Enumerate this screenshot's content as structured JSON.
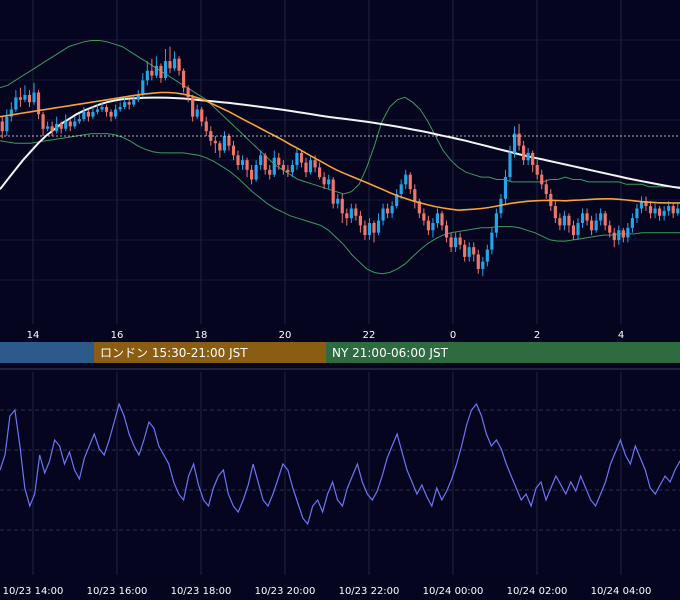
{
  "chart_data": [
    {
      "type": "candlestick",
      "x_tick_labels": [
        "14",
        "16",
        "18",
        "20",
        "22",
        "0",
        "2",
        "4"
      ],
      "candles_ohlc": [
        [
          108,
          104,
          110,
          101
        ],
        [
          104,
          110,
          113,
          102
        ],
        [
          110,
          113,
          116,
          108
        ],
        [
          113,
          118,
          121,
          112
        ],
        [
          118,
          117,
          122,
          114
        ],
        [
          117,
          119,
          123,
          116
        ],
        [
          119,
          116,
          121,
          114
        ],
        [
          116,
          120,
          124,
          115
        ],
        [
          120,
          111,
          121,
          109
        ],
        [
          111,
          105,
          112,
          102
        ],
        [
          105,
          106,
          108,
          104
        ],
        [
          106,
          104,
          108,
          102
        ],
        [
          104,
          107,
          110,
          103
        ],
        [
          107,
          105,
          108,
          103
        ],
        [
          105,
          108,
          111,
          104
        ],
        [
          108,
          106,
          109,
          104
        ],
        [
          106,
          108,
          110,
          105
        ],
        [
          108,
          109,
          111,
          107
        ],
        [
          109,
          112,
          114,
          108
        ],
        [
          112,
          110,
          113,
          108
        ],
        [
          110,
          112,
          114,
          109
        ],
        [
          112,
          113,
          115,
          111
        ],
        [
          113,
          114,
          116,
          112
        ],
        [
          114,
          112,
          115,
          110
        ],
        [
          112,
          110,
          113,
          108
        ],
        [
          110,
          113,
          115,
          109
        ],
        [
          113,
          114,
          116,
          112
        ],
        [
          114,
          116,
          118,
          113
        ],
        [
          116,
          115,
          117,
          113
        ],
        [
          115,
          117,
          119,
          114
        ],
        [
          117,
          119,
          121,
          116
        ],
        [
          119,
          125,
          128,
          118
        ],
        [
          125,
          129,
          133,
          123
        ],
        [
          129,
          127,
          134,
          125
        ],
        [
          127,
          131,
          135,
          126
        ],
        [
          131,
          126,
          132,
          124
        ],
        [
          126,
          133,
          138,
          125
        ],
        [
          133,
          130,
          139,
          128
        ],
        [
          130,
          134,
          137,
          129
        ],
        [
          134,
          129,
          135,
          127
        ],
        [
          129,
          122,
          130,
          120
        ],
        [
          122,
          118,
          123,
          116
        ],
        [
          118,
          110,
          119,
          108
        ],
        [
          110,
          113,
          115,
          109
        ],
        [
          113,
          108,
          114,
          106
        ],
        [
          108,
          104,
          110,
          102
        ],
        [
          104,
          100,
          106,
          98
        ],
        [
          100,
          99,
          102,
          95
        ],
        [
          99,
          96,
          100,
          93
        ],
        [
          96,
          102,
          104,
          95
        ],
        [
          102,
          98,
          103,
          96
        ],
        [
          98,
          94,
          100,
          92
        ],
        [
          94,
          90,
          96,
          88
        ],
        [
          90,
          92,
          94,
          88
        ],
        [
          92,
          88,
          93,
          85
        ],
        [
          88,
          84,
          90,
          82
        ],
        [
          84,
          90,
          92,
          83
        ],
        [
          90,
          94,
          96,
          88
        ],
        [
          94,
          88,
          95,
          86
        ],
        [
          88,
          86,
          90,
          84
        ],
        [
          86,
          93,
          96,
          85
        ],
        [
          93,
          90,
          95,
          88
        ],
        [
          90,
          88,
          92,
          86
        ],
        [
          88,
          87,
          90,
          85
        ],
        [
          87,
          90,
          92,
          85
        ],
        [
          90,
          95,
          97,
          88
        ],
        [
          95,
          91,
          96,
          89
        ],
        [
          91,
          87,
          93,
          85
        ],
        [
          87,
          92,
          94,
          86
        ],
        [
          92,
          89,
          94,
          87
        ],
        [
          89,
          85,
          91,
          84
        ],
        [
          85,
          82,
          87,
          80
        ],
        [
          82,
          84,
          86,
          80
        ],
        [
          84,
          74,
          85,
          72
        ],
        [
          74,
          76,
          78,
          72
        ],
        [
          76,
          70,
          78,
          66
        ],
        [
          70,
          68,
          72,
          65
        ],
        [
          68,
          72,
          74,
          66
        ],
        [
          72,
          69,
          74,
          67
        ],
        [
          69,
          65,
          71,
          62
        ],
        [
          65,
          61,
          67,
          59
        ],
        [
          61,
          66,
          68,
          59
        ],
        [
          66,
          62,
          67,
          58
        ],
        [
          62,
          67,
          70,
          61
        ],
        [
          67,
          72,
          74,
          65
        ],
        [
          72,
          70,
          74,
          68
        ],
        [
          70,
          73,
          75,
          68
        ],
        [
          73,
          78,
          80,
          72
        ],
        [
          78,
          82,
          84,
          76
        ],
        [
          82,
          86,
          88,
          80
        ],
        [
          86,
          80,
          87,
          78
        ],
        [
          80,
          75,
          82,
          72
        ],
        [
          75,
          70,
          76,
          68
        ],
        [
          70,
          67,
          72,
          65
        ],
        [
          67,
          63,
          69,
          61
        ],
        [
          63,
          66,
          68,
          60
        ],
        [
          66,
          70,
          72,
          64
        ],
        [
          70,
          65,
          71,
          63
        ],
        [
          65,
          60,
          67,
          58
        ],
        [
          60,
          56,
          62,
          54
        ],
        [
          56,
          60,
          62,
          54
        ],
        [
          60,
          57,
          62,
          55
        ],
        [
          57,
          52,
          59,
          50
        ],
        [
          52,
          56,
          58,
          50
        ],
        [
          56,
          53,
          58,
          50
        ],
        [
          53,
          47,
          55,
          45
        ],
        [
          47,
          50,
          52,
          44
        ],
        [
          50,
          55,
          57,
          48
        ],
        [
          55,
          62,
          64,
          53
        ],
        [
          62,
          70,
          72,
          60
        ],
        [
          70,
          76,
          78,
          68
        ],
        [
          76,
          85,
          88,
          74
        ],
        [
          85,
          95,
          98,
          83
        ],
        [
          95,
          103,
          106,
          93
        ],
        [
          103,
          98,
          107,
          96
        ],
        [
          98,
          92,
          100,
          90
        ],
        [
          92,
          95,
          97,
          90
        ],
        [
          95,
          90,
          96,
          87
        ],
        [
          90,
          86,
          92,
          84
        ],
        [
          86,
          82,
          88,
          80
        ],
        [
          82,
          78,
          84,
          76
        ],
        [
          78,
          73,
          80,
          71
        ],
        [
          73,
          68,
          75,
          66
        ],
        [
          68,
          65,
          70,
          63
        ],
        [
          65,
          69,
          71,
          63
        ],
        [
          69,
          65,
          70,
          62
        ],
        [
          65,
          61,
          67,
          59
        ],
        [
          61,
          66,
          68,
          59
        ],
        [
          66,
          70,
          72,
          64
        ],
        [
          70,
          67,
          72,
          65
        ],
        [
          67,
          63,
          69,
          61
        ],
        [
          63,
          67,
          70,
          62
        ],
        [
          67,
          70,
          72,
          65
        ],
        [
          70,
          65,
          71,
          63
        ],
        [
          65,
          62,
          67,
          60
        ],
        [
          62,
          59,
          64,
          56
        ],
        [
          59,
          63,
          65,
          57
        ],
        [
          63,
          60,
          64,
          58
        ],
        [
          60,
          64,
          66,
          58
        ],
        [
          64,
          68,
          70,
          62
        ],
        [
          68,
          72,
          74,
          66
        ],
        [
          72,
          75,
          77,
          70
        ],
        [
          75,
          73,
          77,
          71
        ],
        [
          73,
          70,
          75,
          68
        ],
        [
          70,
          72,
          74,
          68
        ],
        [
          72,
          69,
          73,
          67
        ],
        [
          69,
          71,
          73,
          67
        ],
        [
          71,
          73,
          75,
          69
        ],
        [
          73,
          70,
          74,
          68
        ],
        [
          70,
          72,
          74,
          69
        ]
      ],
      "sma_mid_values": [
        110,
        110.5,
        111,
        111.5,
        112,
        112.5,
        113,
        113.5,
        114,
        114.5,
        115,
        115.5,
        116,
        116.5,
        117,
        117.5,
        118,
        118.5,
        119,
        119.4,
        119.7,
        120,
        120,
        119.8,
        119.3,
        118.6,
        117.7,
        116.5,
        115,
        113.5,
        112,
        110.3,
        108.6,
        107,
        105.3,
        103.6,
        102,
        100.3,
        98.5,
        96.8,
        95,
        93.2,
        91.5,
        89.7,
        88,
        86.6,
        85.3,
        84,
        82.7,
        81.3,
        80,
        78.6,
        77.3,
        76.2,
        75.2,
        74.3,
        73.5,
        72.8,
        72.2,
        71.7,
        71.3,
        71.5,
        71.7,
        72,
        72.4,
        73,
        73.6,
        74.2,
        74.6,
        75,
        75.2,
        75.3,
        75.4,
        75.3,
        75.2,
        75.4,
        75.5,
        75.7,
        75.9,
        76,
        76,
        75.8,
        75.5,
        75.2,
        74.8,
        74.6,
        74.4,
        74.3,
        74.3,
        74.3
      ],
      "long_ma_values": [
        80,
        84,
        88,
        92,
        95.5,
        99,
        102,
        104.5,
        107,
        109,
        111,
        112.5,
        113.8,
        115,
        116,
        116.7,
        117.2,
        117.5,
        117.7,
        117.8,
        117.9,
        117.9,
        117.8,
        117.7,
        117.5,
        117.2,
        116.9,
        116.6,
        116.3,
        116,
        115.7,
        115.3,
        114.9,
        114.5,
        114.1,
        113.7,
        113.3,
        112.9,
        112.4,
        111.9,
        111.4,
        110.9,
        110.4,
        109.9,
        109.5,
        109.1,
        108.7,
        108.3,
        107.9,
        107.4,
        106.9,
        106.4,
        105.9,
        105.3,
        104.7,
        104.1,
        103.5,
        102.8,
        102.1,
        101.4,
        100.7,
        100,
        99.2,
        98.4,
        97.6,
        96.8,
        96,
        95.2,
        94.4,
        93.7,
        93,
        92.3,
        91.6,
        90.9,
        90.2,
        89.5,
        88.8,
        88.1,
        87.4,
        86.7,
        86,
        85.3,
        84.6,
        83.9,
        83.3,
        82.7,
        82.1,
        81.5,
        81,
        80.5
      ],
      "bollinger_upper_values": [
        122,
        123,
        125,
        127,
        129,
        131,
        133,
        135,
        137,
        139,
        140,
        141,
        141.5,
        141.5,
        141,
        140,
        139,
        137,
        135,
        133,
        131,
        129,
        127,
        125,
        123,
        121,
        119,
        117,
        114,
        111,
        108,
        105,
        102,
        99,
        96,
        93,
        90,
        88,
        86,
        84,
        83,
        82,
        81,
        80,
        79,
        78,
        79,
        82,
        89,
        98,
        108,
        114,
        117,
        118,
        116,
        113,
        108,
        102,
        96,
        92,
        89,
        87,
        86,
        85,
        85,
        84,
        84,
        83,
        83,
        83,
        83,
        83,
        84,
        84,
        85,
        84,
        84,
        83,
        83,
        83,
        83,
        83,
        82,
        82,
        82,
        81,
        81,
        81,
        81,
        81
      ],
      "bollinger_lower_values": [
        100,
        99.5,
        99,
        99,
        99,
        99.5,
        100,
        100.5,
        101,
        101.5,
        102,
        102.5,
        103,
        103,
        103,
        102.5,
        101.5,
        100,
        98,
        96.5,
        95.5,
        95,
        95,
        95,
        95,
        94.5,
        94,
        93,
        91.5,
        89.5,
        87.5,
        85,
        82,
        79,
        76.5,
        74,
        72,
        70.5,
        69,
        68,
        67,
        66,
        65,
        63,
        60,
        57,
        53,
        50,
        47,
        45.5,
        45,
        45.5,
        47,
        49,
        52,
        55,
        57.5,
        59.5,
        61,
        62,
        62.5,
        63,
        63.5,
        64,
        64,
        64.5,
        64.5,
        64.5,
        64,
        63,
        62,
        60.5,
        59,
        58.5,
        58.5,
        59,
        59.5,
        60,
        60.5,
        61,
        61,
        61.5,
        61.5,
        61.5,
        62,
        62,
        62,
        62,
        62,
        62
      ],
      "dashed_reference_level": 102
    },
    {
      "type": "line",
      "x_tick_labels": [
        "10/23 14:00",
        "10/23 16:00",
        "10/23 18:00",
        "10/23 20:00",
        "10/23 22:00",
        "10/24 00:00",
        "10/24 02:00",
        "10/24 04:00"
      ],
      "values": [
        50,
        55,
        68,
        70,
        58,
        44,
        38,
        42,
        55,
        49,
        53,
        60,
        58,
        52,
        56,
        50,
        47,
        54,
        58,
        62,
        57,
        55,
        60,
        66,
        72,
        68,
        62,
        58,
        55,
        60,
        66,
        64,
        58,
        55,
        52,
        46,
        42,
        40,
        48,
        52,
        45,
        40,
        38,
        44,
        48,
        50,
        42,
        38,
        36,
        40,
        45,
        52,
        46,
        40,
        38,
        42,
        47,
        52,
        50,
        44,
        39,
        34,
        32,
        38,
        40,
        36,
        42,
        46,
        40,
        38,
        44,
        48,
        52,
        46,
        42,
        40,
        43,
        48,
        54,
        58,
        62,
        56,
        50,
        46,
        42,
        45,
        41,
        38,
        44,
        40,
        43,
        47,
        52,
        58,
        65,
        70,
        72,
        68,
        62,
        58,
        60,
        57,
        52,
        48,
        44,
        40,
        42,
        38,
        44,
        46,
        40,
        44,
        48,
        45,
        42,
        46,
        43,
        48,
        44,
        40,
        38,
        42,
        46,
        52,
        56,
        60,
        55,
        52,
        58,
        54,
        50,
        44,
        42,
        45,
        48,
        46,
        50,
        53
      ],
      "ylim": [
        20,
        80
      ]
    }
  ],
  "session_bar": {
    "tokyo": {
      "label": "",
      "color": "#2c5a8a"
    },
    "london": {
      "label": "ロンドン 15:30-21:00 JST",
      "color": "#8a5d12"
    },
    "ny": {
      "label": "NY 21:00-06:00 JST",
      "color": "#2e6b40"
    }
  },
  "colors": {
    "background": "#050520",
    "bull_candle": "#26a4e8",
    "bear_candle": "#f0766a",
    "sma_mid": "#f7a23a",
    "long_ma": "#f4f4f4",
    "bollinger": "#3f9a5a",
    "oscillator": "#6f74f2",
    "grid": "#1e2440",
    "axis_text": "#ffffff"
  }
}
